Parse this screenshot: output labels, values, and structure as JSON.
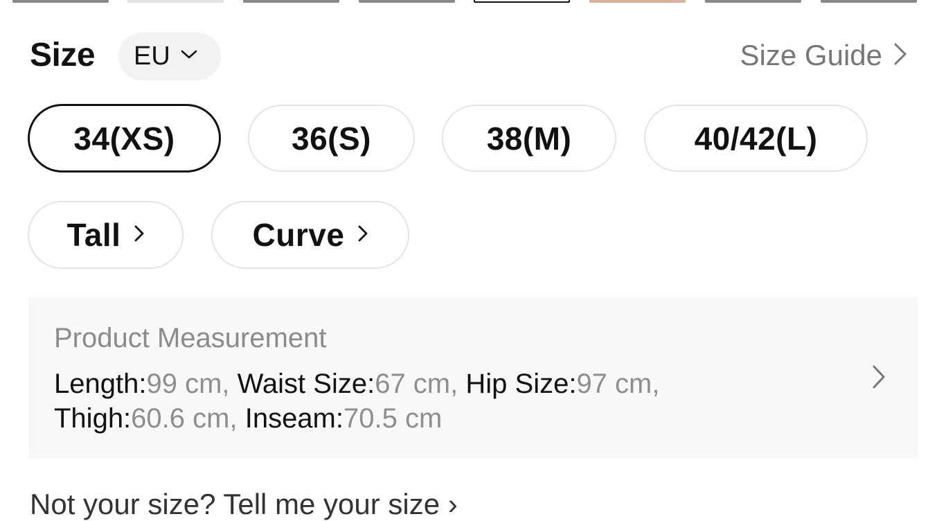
{
  "colors": {
    "text_primary": "#111111",
    "text_secondary": "#777777",
    "pill_border": "#e4e4e4",
    "selected_border": "#111111",
    "panel_bg": "#f8f8f8"
  },
  "header": {
    "size_label": "Size",
    "region": {
      "value": "EU",
      "icon": "chevron-down-icon"
    },
    "size_guide": {
      "label": "Size Guide",
      "icon": "chevron-right-icon"
    }
  },
  "sizes": [
    {
      "label": "34(XS)",
      "selected": true
    },
    {
      "label": "36(S)",
      "selected": false
    },
    {
      "label": "38(M)",
      "selected": false
    },
    {
      "label": "40/42(L)",
      "selected": false
    }
  ],
  "fits": [
    {
      "label": "Tall",
      "icon": "chevron-right-icon"
    },
    {
      "label": "Curve",
      "icon": "chevron-right-icon"
    }
  ],
  "measurement": {
    "title": "Product Measurement",
    "items": [
      {
        "key": "Length:",
        "value": "99 cm,"
      },
      {
        "key": "Waist Size:",
        "value": "67 cm,"
      },
      {
        "key": "Hip Size:",
        "value": "97 cm,"
      },
      {
        "key": "Thigh:",
        "value": "60.6 cm,"
      },
      {
        "key": "Inseam:",
        "value": "70.5 cm"
      }
    ],
    "icon": "chevron-right-icon"
  },
  "footer": {
    "text": "Not your size? Tell me your size ›"
  }
}
